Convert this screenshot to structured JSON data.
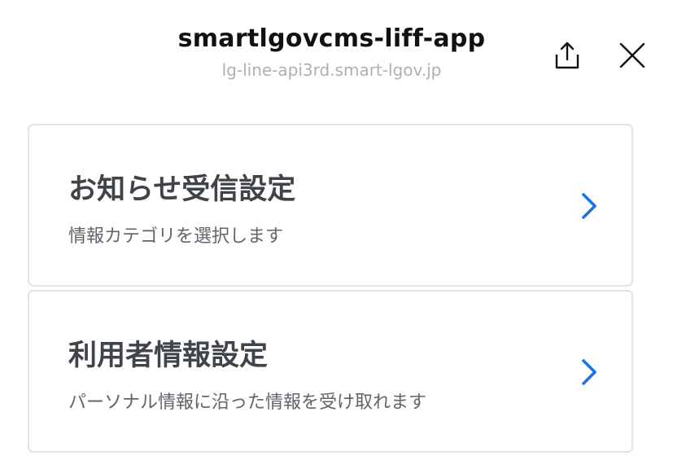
{
  "header": {
    "title": "smartlgovcms-liff-app",
    "domain": "lg-line-api3rd.smart-lgov.jp",
    "share_icon": "share-icon",
    "close_icon": "close-icon"
  },
  "menu": {
    "items": [
      {
        "title": "お知らせ受信設定",
        "description": "情報カテゴリを選択します",
        "icon": "chevron-right-icon"
      },
      {
        "title": "利用者情報設定",
        "description": "パーソナル情報に沿った情報を受け取れます",
        "icon": "chevron-right-icon"
      }
    ]
  },
  "colors": {
    "accent": "#1a73e8",
    "title_text": "#111111",
    "subtitle_text": "#b0b0b0",
    "card_border": "#e2e2e2",
    "card_title": "#3f434a",
    "card_desc": "#60646b"
  }
}
